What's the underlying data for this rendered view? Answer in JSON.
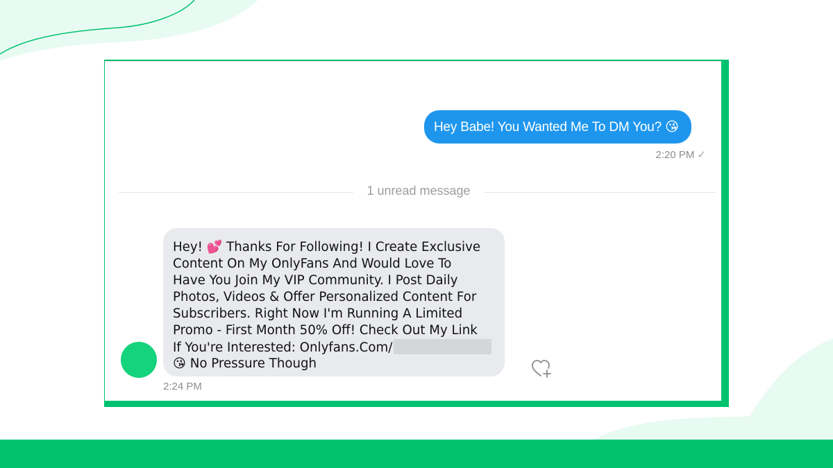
{
  "conversation": {
    "outgoing": {
      "text": "Hey Babe! You Wanted Me To DM You? ",
      "emoji": "😘",
      "time": "2:20 PM",
      "status_icon": "check-icon"
    },
    "unread_divider": "1 unread message",
    "incoming": {
      "lines": [
        {
          "pre": "Hey! ",
          "emoji": "💕",
          "post": " Thanks For Following! I Create Exclusive"
        },
        {
          "text": "Content On My OnlyFans And Would Love To"
        },
        {
          "text": "Have You Join My VIP Community. I Post Daily"
        },
        {
          "text": "Photos, Videos & Offer Personalized Content For"
        },
        {
          "text": "Subscribers. Right Now I'm Running A Limited"
        },
        {
          "text": "Promo - First Month 50% Off! Check Out My Link"
        },
        {
          "text": "If You're Interested: Onlyfans.Com/"
        },
        {
          "emoji": "😘",
          "post": " No Pressure Though"
        }
      ],
      "time": "2:24 PM",
      "reaction_icon": "heart-plus-icon"
    }
  },
  "colors": {
    "accent_green": "#00c26f",
    "outgoing_bubble": "#1e96ee",
    "incoming_bubble": "#e9eaed",
    "avatar": "#15d27c"
  }
}
